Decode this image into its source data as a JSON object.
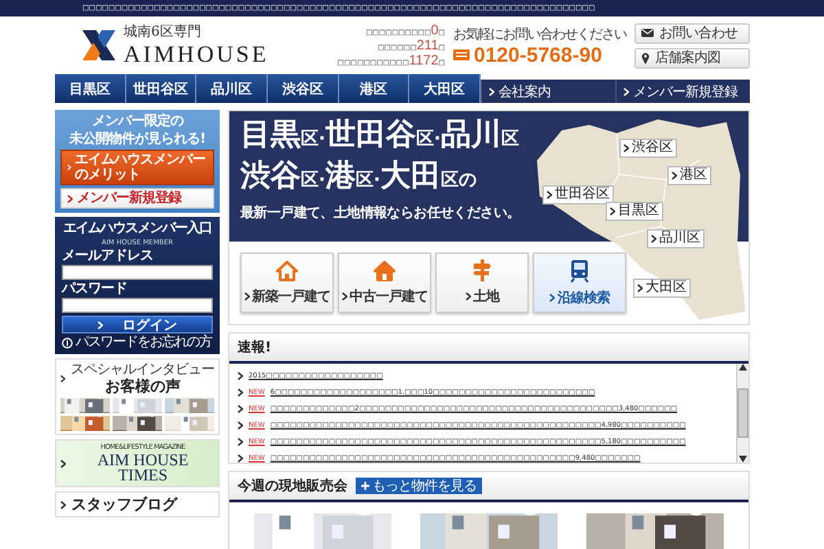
{
  "top_bar": {
    "text": "□□□□□□□□□□□□□□□□□□□□□□□□□□□□□□□□□□□□□□□□□□□□□□□□□□□□□□□□□□□□□□□□□□□□□□□□□□□□□□□"
  },
  "header": {
    "tagline": "城南6区専門",
    "brand": "AIMHOUSE",
    "stats": [
      {
        "before": "□□□□□□□□□□",
        "number": "0",
        "after": "□"
      },
      {
        "before": "□□□□□□",
        "number": "211",
        "after": "□"
      },
      {
        "before": "□□□□□□□□□□□",
        "number": "1172",
        "after": "□"
      }
    ],
    "contact": {
      "hint": "お気軽にお問い合わせください",
      "phone": "0120-5768-90"
    },
    "buttons": [
      {
        "kind": "mail",
        "label": "お問い合わせ"
      },
      {
        "kind": "pin",
        "label": "店舗案内図"
      }
    ]
  },
  "nav": {
    "areas": [
      "目黒区",
      "世田谷区",
      "品川区",
      "渋谷区",
      "港区",
      "大田区"
    ],
    "links": [
      "会社案内",
      "メンバー新規登録"
    ]
  },
  "sidebar": {
    "member_banner": {
      "lines": [
        "メンバー限定の",
        "未公開物件が見られる!"
      ],
      "buttons": [
        {
          "kind": "orange",
          "label": "エイムハウスメンバーのメリット"
        },
        {
          "kind": "white",
          "label": "メンバー新規登録"
        }
      ]
    },
    "login": {
      "title": "エイムハウスメンバー入口",
      "subtitle": "AIM HOUSE MEMBER",
      "fields": [
        {
          "label": "メールアドレス"
        },
        {
          "label": "パスワード"
        }
      ],
      "button": "ログイン",
      "forgot": "パスワードをお忘れの方"
    },
    "interview": {
      "kicker": "スペシャルインタビュー",
      "title": "お客様の声"
    },
    "magazine": {
      "kicker": "HOME&LIFESTYLE MAGAZINE",
      "title_lines": [
        "AIM HOUSE",
        "TIMES"
      ]
    },
    "blog": {
      "title": "スタッフブログ"
    }
  },
  "hero": {
    "headline": [
      [
        {
          "text": "目黒",
          "kind": "large"
        },
        {
          "text": "区·",
          "kind": "small"
        },
        {
          "text": "世田谷",
          "kind": "large"
        },
        {
          "text": "区·",
          "kind": "small"
        },
        {
          "text": "品川",
          "kind": "large"
        },
        {
          "text": "区",
          "kind": "small"
        }
      ],
      [
        {
          "text": "渋谷",
          "kind": "large"
        },
        {
          "text": "区·",
          "kind": "small"
        },
        {
          "text": "港",
          "kind": "large"
        },
        {
          "text": "区·",
          "kind": "small"
        },
        {
          "text": "大田",
          "kind": "large"
        },
        {
          "text": "区の",
          "kind": "small"
        }
      ]
    ],
    "subtitle": "最新一戸建て、土地情報ならお任せください。",
    "categories": [
      {
        "kind": "new_house",
        "label": "新築一戸建て",
        "selected": false
      },
      {
        "kind": "used_house",
        "label": "中古一戸建て",
        "selected": false
      },
      {
        "kind": "land",
        "label": "土地",
        "selected": false
      },
      {
        "kind": "train",
        "label": "沿線検索",
        "selected": true
      }
    ],
    "map_labels": [
      "渋谷区",
      "港区",
      "世田谷区",
      "目黒区",
      "品川区",
      "大田区"
    ]
  },
  "news": {
    "title": "速報!",
    "items": [
      {
        "text": "2015□□□□□□□□□□□□□□□□□□"
      },
      {
        "badge": "NEW",
        "text": "6□□□□□□□□□□□□□□□□□□□1.□□□10□□□□□□□□□□□□□□□□□□□□□□□□□"
      },
      {
        "badge": "NEW",
        "text": "□□□□□□□□□□□□□2□□□□□□□□□□□□□□□□□□□□□□□□□□□□□□□□□□□□□□□□3,480□□□□□□"
      },
      {
        "badge": "NEW",
        "text": "□□□□□□□□□□□□□□□□□□□□□□□□□□□□□□□□□□□□□□□□□□□□□□□□□□□4,980□□□□□□□□□□"
      },
      {
        "badge": "NEW",
        "text": "□□□□□□□□□□□□□□□□□□□□□□□□□□□□□□□□□□□□□□□□□□□□□□□□□□□5,180□□□□□□□□□□"
      },
      {
        "badge": "NEW",
        "text": "□□□□□□□□□□□□□□□□□□□□□□□□□□□□□□□□□□□□□□□□□□□□□□□9,480□□□□□□□"
      }
    ]
  },
  "open_house": {
    "title": "今週の現地販売会",
    "more_button": "もっと物件を見る"
  }
}
